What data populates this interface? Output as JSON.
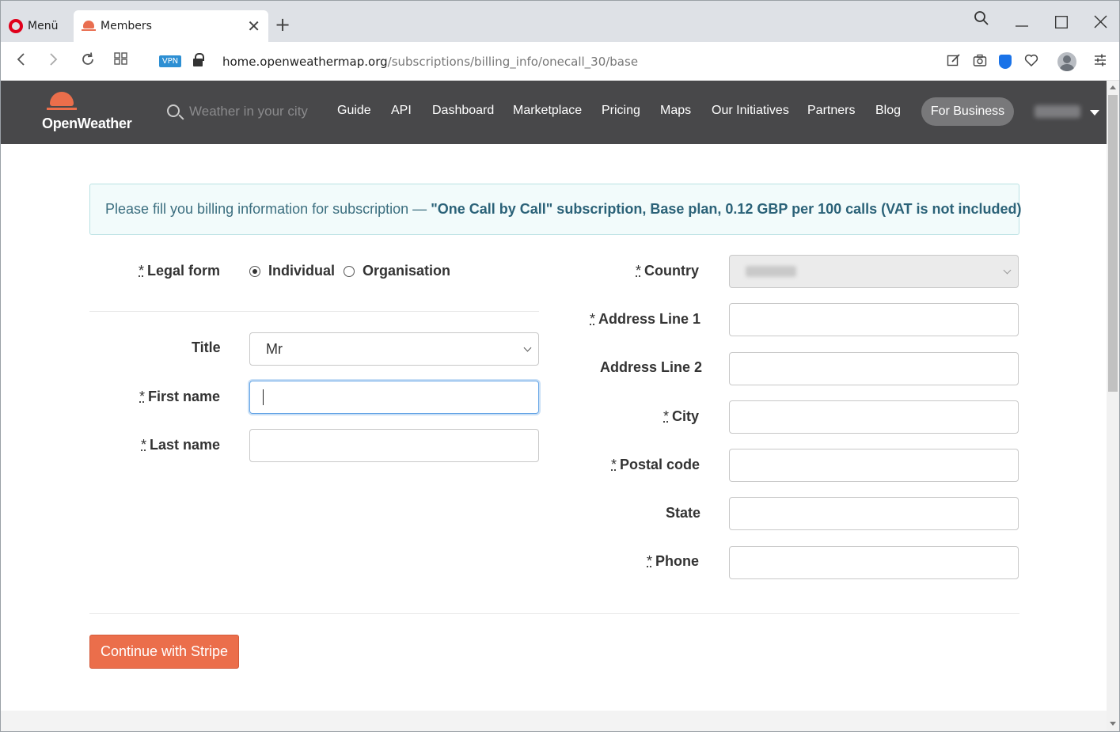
{
  "browser": {
    "menu_label": "Menü",
    "tab_title": "Members",
    "url_host": "home.openweathermap.org",
    "url_path": "/subscriptions/billing_info/onecall_30/base",
    "vpn_label": "VPN",
    "icons": [
      "opera-logo-icon",
      "tab-close-icon",
      "new-tab-icon",
      "search-tabs-icon",
      "minimize-icon",
      "maximize-icon",
      "close-window-icon",
      "back-icon",
      "forward-icon",
      "reload-icon",
      "tab-grid-icon",
      "lock-icon",
      "snapshot-edit-icon",
      "camera-icon",
      "adblock-shield-icon",
      "heart-icon",
      "profile-avatar-icon",
      "easy-setup-icon"
    ]
  },
  "header": {
    "logo_text": "OpenWeather",
    "search_placeholder": "Weather in your city",
    "nav": [
      "Guide",
      "API",
      "Dashboard",
      "Marketplace",
      "Pricing",
      "Maps",
      "Our Initiatives",
      "Partners",
      "Blog"
    ],
    "for_business": "For Business"
  },
  "alert": {
    "prefix": "Please fill you billing information for subscription — ",
    "highlight": "\"One Call by Call\" subscription, Base plan, 0.12 GBP per 100 calls (VAT is not included)"
  },
  "form": {
    "required_mark": "*",
    "legal_form_label": "Legal form",
    "legal_options": [
      "Individual",
      "Organisation"
    ],
    "legal_selected": "Individual",
    "title_label": "Title",
    "title_value": "Mr",
    "first_name_label": "First name",
    "first_name_value": "",
    "last_name_label": "Last name",
    "last_name_value": "",
    "country_label": "Country",
    "address1_label": "Address Line 1",
    "address2_label": "Address Line 2",
    "city_label": "City",
    "postal_label": "Postal code",
    "state_label": "State",
    "phone_label": "Phone",
    "submit_label": "Continue with Stripe"
  },
  "colors": {
    "brand_orange": "#eb6e4b",
    "header_bg": "#48484a",
    "alert_bg": "#f2fbfb",
    "alert_text": "#3b6e7f"
  }
}
